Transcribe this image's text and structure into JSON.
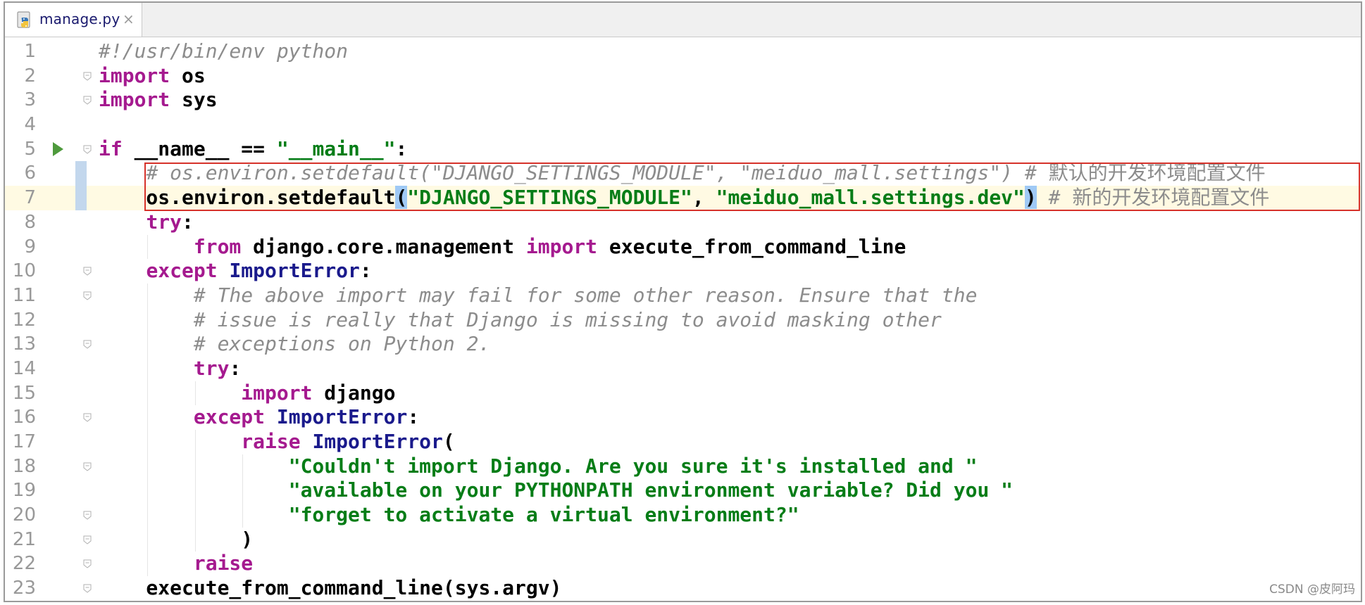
{
  "tab": {
    "filename": "manage.py",
    "file_icon": "python-file-icon",
    "close_icon": "close-icon"
  },
  "lines": [
    {
      "num": "1",
      "tokens": [
        {
          "t": "#!/usr/bin/env python",
          "c": "cmt"
        }
      ]
    },
    {
      "num": "2",
      "fold": true,
      "tokens": [
        {
          "t": "import",
          "c": "kw"
        },
        {
          "t": " os",
          "c": "plain"
        }
      ]
    },
    {
      "num": "3",
      "fold": true,
      "tokens": [
        {
          "t": "import",
          "c": "kw"
        },
        {
          "t": " sys",
          "c": "plain"
        }
      ]
    },
    {
      "num": "4",
      "tokens": []
    },
    {
      "num": "5",
      "fold": true,
      "run": true,
      "tokens": [
        {
          "t": "if",
          "c": "kw"
        },
        {
          "t": " __name__ == ",
          "c": "plain"
        },
        {
          "t": "\"__main__\"",
          "c": "str"
        },
        {
          "t": ":",
          "c": "plain"
        }
      ]
    },
    {
      "num": "6",
      "marker": true,
      "tokens": [
        {
          "t": "    ",
          "c": "plain"
        },
        {
          "t": "# os.environ.setdefault(\"DJANGO_SETTINGS_MODULE\", \"meiduo_mall.settings\") # ",
          "c": "cmt"
        },
        {
          "t": "默认的开发环境配置文件",
          "c": "cmt cjk"
        }
      ]
    },
    {
      "num": "7",
      "marker": true,
      "current": true,
      "tokens": [
        {
          "t": "    os.environ.setdefault",
          "c": "plain"
        },
        {
          "t": "(",
          "c": "plain paren-hl"
        },
        {
          "t": "\"DJANGO_SETTINGS_MODULE\"",
          "c": "str"
        },
        {
          "t": ", ",
          "c": "plain"
        },
        {
          "t": "\"meiduo_mall.settings.dev\"",
          "c": "str"
        },
        {
          "t": ")",
          "c": "plain paren-hl"
        },
        {
          "t": " # ",
          "c": "cmt"
        },
        {
          "t": "新的开发环境配置文件",
          "c": "cmt cjk"
        }
      ]
    },
    {
      "num": "8",
      "tokens": [
        {
          "t": "    ",
          "c": "plain"
        },
        {
          "t": "try",
          "c": "kw"
        },
        {
          "t": ":",
          "c": "plain"
        }
      ]
    },
    {
      "num": "9",
      "tokens": [
        {
          "t": "        ",
          "c": "plain"
        },
        {
          "t": "from",
          "c": "kw"
        },
        {
          "t": " django.core.management ",
          "c": "plain"
        },
        {
          "t": "import",
          "c": "kw"
        },
        {
          "t": " execute_from_command_line",
          "c": "plain"
        }
      ]
    },
    {
      "num": "10",
      "fold": true,
      "tokens": [
        {
          "t": "    ",
          "c": "plain"
        },
        {
          "t": "except",
          "c": "kw"
        },
        {
          "t": " ",
          "c": "plain"
        },
        {
          "t": "ImportError",
          "c": "cls"
        },
        {
          "t": ":",
          "c": "plain"
        }
      ]
    },
    {
      "num": "11",
      "fold": true,
      "tokens": [
        {
          "t": "        ",
          "c": "plain"
        },
        {
          "t": "# The above import may fail for some other reason. Ensure that the",
          "c": "cmt"
        }
      ]
    },
    {
      "num": "12",
      "tokens": [
        {
          "t": "        ",
          "c": "plain"
        },
        {
          "t": "# issue is really that Django is missing to avoid masking other",
          "c": "cmt"
        }
      ]
    },
    {
      "num": "13",
      "fold": true,
      "tokens": [
        {
          "t": "        ",
          "c": "plain"
        },
        {
          "t": "# exceptions on Python 2.",
          "c": "cmt"
        }
      ]
    },
    {
      "num": "14",
      "tokens": [
        {
          "t": "        ",
          "c": "plain"
        },
        {
          "t": "try",
          "c": "kw"
        },
        {
          "t": ":",
          "c": "plain"
        }
      ]
    },
    {
      "num": "15",
      "tokens": [
        {
          "t": "            ",
          "c": "plain"
        },
        {
          "t": "import",
          "c": "kw"
        },
        {
          "t": " django",
          "c": "plain"
        }
      ]
    },
    {
      "num": "16",
      "fold": true,
      "tokens": [
        {
          "t": "        ",
          "c": "plain"
        },
        {
          "t": "except",
          "c": "kw"
        },
        {
          "t": " ",
          "c": "plain"
        },
        {
          "t": "ImportError",
          "c": "cls"
        },
        {
          "t": ":",
          "c": "plain"
        }
      ]
    },
    {
      "num": "17",
      "tokens": [
        {
          "t": "            ",
          "c": "plain"
        },
        {
          "t": "raise",
          "c": "kw"
        },
        {
          "t": " ",
          "c": "plain"
        },
        {
          "t": "ImportError",
          "c": "cls"
        },
        {
          "t": "(",
          "c": "plain"
        }
      ]
    },
    {
      "num": "18",
      "fold": true,
      "tokens": [
        {
          "t": "                ",
          "c": "plain"
        },
        {
          "t": "\"Couldn't import Django. Are you sure it's installed and \"",
          "c": "str"
        }
      ]
    },
    {
      "num": "19",
      "tokens": [
        {
          "t": "                ",
          "c": "plain"
        },
        {
          "t": "\"available on your PYTHONPATH environment variable? Did you \"",
          "c": "str"
        }
      ]
    },
    {
      "num": "20",
      "fold": true,
      "tokens": [
        {
          "t": "                ",
          "c": "plain"
        },
        {
          "t": "\"forget to activate a virtual environment?\"",
          "c": "str"
        }
      ]
    },
    {
      "num": "21",
      "fold": true,
      "tokens": [
        {
          "t": "            )",
          "c": "plain"
        }
      ]
    },
    {
      "num": "22",
      "fold": true,
      "tokens": [
        {
          "t": "        ",
          "c": "plain"
        },
        {
          "t": "raise",
          "c": "kw"
        }
      ]
    },
    {
      "num": "23",
      "fold": true,
      "tokens": [
        {
          "t": "    execute_from_command_line(sys.argv)",
          "c": "plain"
        }
      ]
    }
  ],
  "watermark": "CSDN @皮阿玛",
  "colors": {
    "keyword": "#a51a8f",
    "string": "#067d17",
    "comment": "#8c8c8c",
    "class": "#1a1a8c",
    "highlight_box": "#d6322a",
    "current_line": "#fffae3"
  }
}
